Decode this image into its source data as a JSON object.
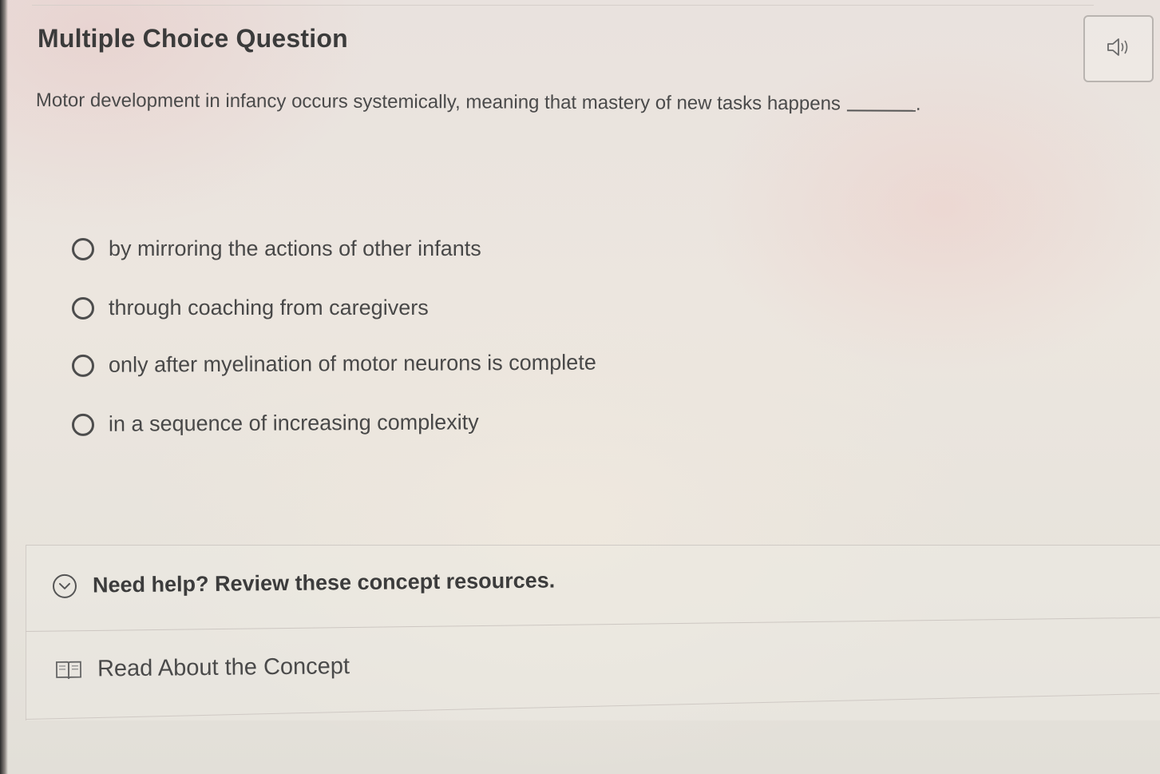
{
  "header": {
    "title": "Multiple Choice Question",
    "audio_icon": "speaker-icon"
  },
  "question": {
    "text": "Motor development in infancy occurs systemically, meaning that mastery of new tasks happens",
    "end_punctuation": "."
  },
  "options": [
    {
      "label": "by mirroring the actions of other infants",
      "selected": false
    },
    {
      "label": "through coaching from caregivers",
      "selected": false
    },
    {
      "label": "only after myelination of motor neurons is complete",
      "selected": false
    },
    {
      "label": "in a sequence of increasing complexity",
      "selected": false
    }
  ],
  "help": {
    "toggle_icon": "chevron-down-icon",
    "text": "Need help? Review these concept resources.",
    "resource_icon": "book-icon",
    "resource_label": "Read About the Concept"
  }
}
